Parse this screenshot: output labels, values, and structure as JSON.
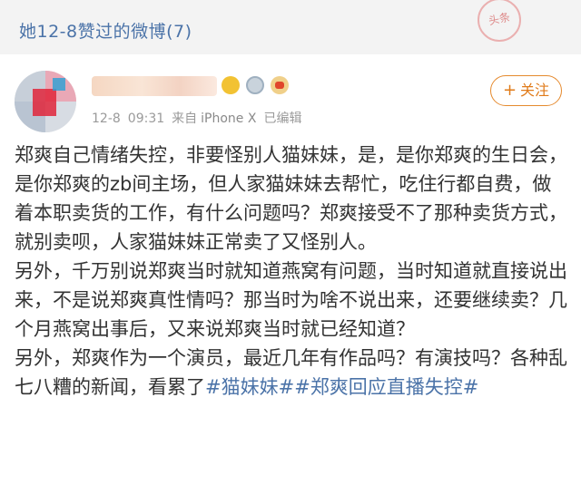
{
  "header": {
    "title": "她12-8赞过的微博(7)",
    "stamp_text": "头条"
  },
  "post": {
    "follow_label": "关注",
    "follow_plus": "+",
    "meta": {
      "date": "12-8",
      "time": "09:31",
      "source_prefix": "来自",
      "device": "iPhone X",
      "edited": "已编辑"
    },
    "paragraphs": [
      "郑爽自己情绪失控，非要怪别人猫妹妹，是，是你郑爽的生日会，是你郑爽的zb间主场，但人家猫妹妹去帮忙，吃住行都自费，做着本职卖货的工作，有什么问题吗？郑爽接受不了那种卖货方式，就别卖呗，人家猫妹妹正常卖了又怪别人。",
      "另外，千万别说郑爽当时就知道燕窝有问题，当时知道就直接说出来，不是说郑爽真性情吗？那当时为啥不说出来，还要继续卖？几个月燕窝出事后，又来说郑爽当时就已经知道？"
    ],
    "last_paragraph_text": "另外，郑爽作为一个演员，最近几年有作品吗？有演技吗？各种乱七八糟的新闻，看累了",
    "hashtags": [
      "#猫妹妹#",
      "#郑爽回应直播失控#"
    ]
  },
  "colors": {
    "link": "#4b73a8",
    "follow_accent": "#e07b1a",
    "meta_gray": "#9a9a9a"
  }
}
